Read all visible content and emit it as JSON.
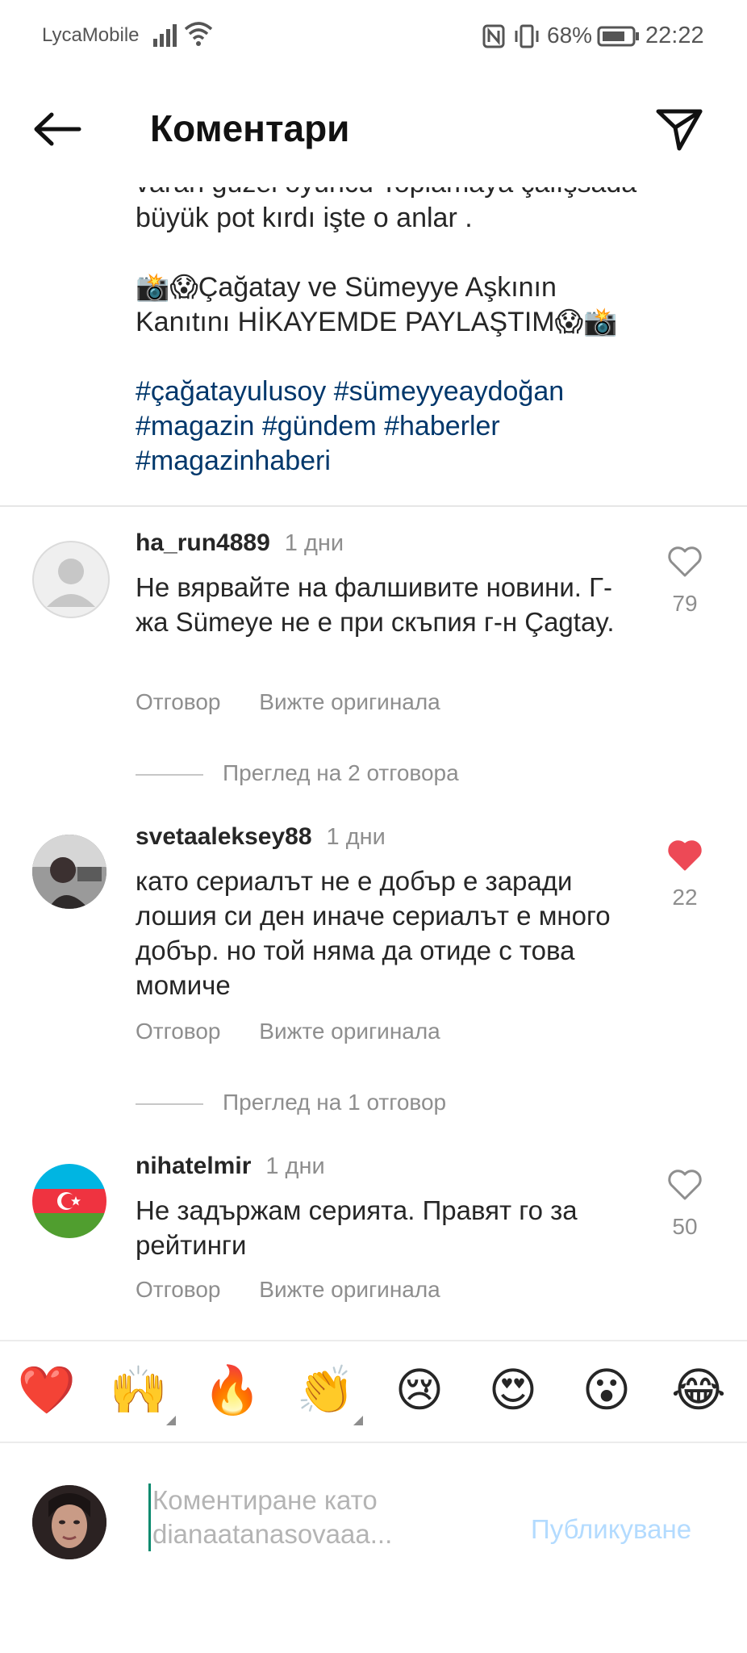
{
  "status_bar": {
    "carrier": "LycaMobile",
    "battery_percent": "68%",
    "time": "22:22"
  },
  "header": {
    "title": "Коментари",
    "back_icon": "arrow-left-icon",
    "send_icon": "paper-plane-icon"
  },
  "caption": {
    "partial_line": "varan güzel oyuncu Toplamaya çalışsada",
    "line2": "büyük pot kırdı işte o anlar .",
    "line3": "📸😱Çağatay ve Sümeyye Aşkının",
    "line4": "Kanıtını HİKAYEMDE PAYLAŞTIM😱📸",
    "tags_line1": "#çağatayulusoy #sümeyyeaydoğan",
    "tags_line2": "#magazin #gündem #haberler",
    "tags_line3": "#magazinhaberi"
  },
  "comments": [
    {
      "username": "ha_run4889",
      "time": "1 дни",
      "text": "Не вярвайте на фалшивите новини. Г-жа Sümeye не е при скъпия г-н Çagtay.",
      "likes": "79",
      "liked": false,
      "reply_label": "Отговор",
      "see_original": "Вижте оригинала",
      "view_replies": "Преглед на 2 отговора",
      "avatar": "default-avatar"
    },
    {
      "username": "svetaaleksey88",
      "time": "1 дни",
      "text": "като сериалът не е добър е заради лошия си ден иначе сериалът е много добър. но той няма да отиде с това момиче",
      "likes": "22",
      "liked": true,
      "reply_label": "Отговор",
      "see_original": "Вижте оригинала",
      "view_replies": "Преглед на 1 отговор",
      "avatar": "photo-avatar"
    },
    {
      "username": "nihatelmir",
      "time": "1 дни",
      "text": "Не задържам серията. Правят го за рейтинги",
      "likes": "50",
      "liked": false,
      "reply_label": "Отговор",
      "see_original": "Вижте оригинала",
      "avatar": "azerbaijan-flag-avatar"
    }
  ],
  "emoji_bar": [
    "❤️",
    "🙌",
    "🔥",
    "👏",
    "😢",
    "😍",
    "😮",
    "😂"
  ],
  "composer": {
    "placeholder": "Коментиране като dianaatanasovaaa...",
    "post_label": "Публикуване"
  },
  "colors": {
    "hashtag": "#00376b",
    "liked_heart": "#ed4956",
    "post_button_disabled": "#b3dbff",
    "secondary_text": "#8e8e8e"
  }
}
